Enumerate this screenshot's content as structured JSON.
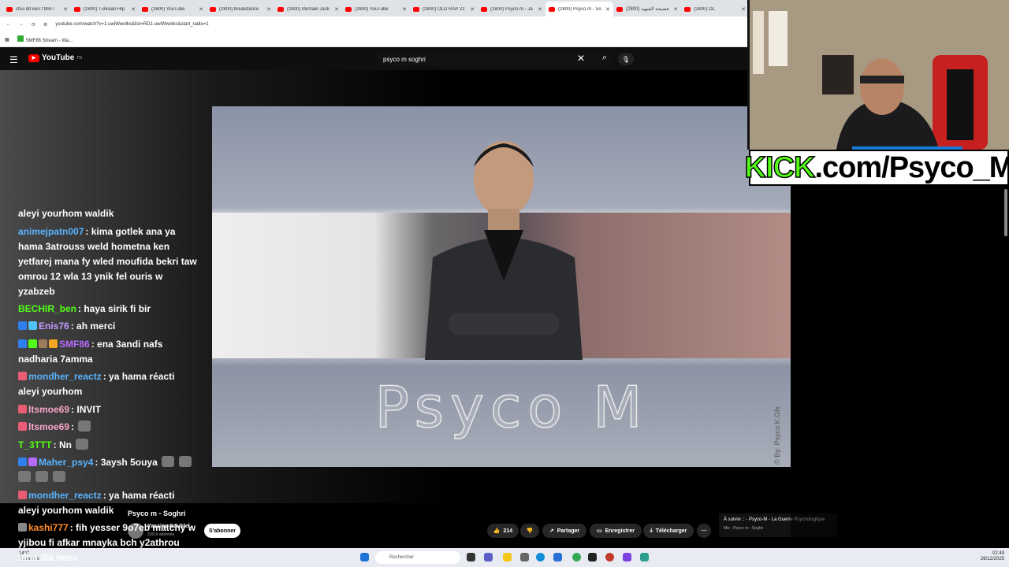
{
  "browser": {
    "tabs": [
      {
        "label": "chui dd ken f titre l",
        "active": false
      },
      {
        "label": "(2800) Tunisian Hip",
        "active": false
      },
      {
        "label": "(2800) YouTube",
        "active": false
      },
      {
        "label": "(2800) breakdance",
        "active": false
      },
      {
        "label": "(2800) Michael Jack",
        "active": false
      },
      {
        "label": "(2800) YouTube",
        "active": false
      },
      {
        "label": "(2800) OLD RAP 21",
        "active": false
      },
      {
        "label": "(2800) Psyco m - Ja",
        "active": false
      },
      {
        "label": "(2800) Psyco m - So",
        "active": true
      },
      {
        "label": "فضيحة الشهيد (2800)",
        "active": false
      },
      {
        "label": "(2800) OL",
        "active": false
      }
    ],
    "url": "youtube.com/watch?v=1-uwiWwolks&list=RD1-uwiWwolks&start_radio=1",
    "bookmarks": [
      "SMF86 Stream - Wa..."
    ]
  },
  "youtube": {
    "logo_text": "YouTube",
    "logo_sup": "TN",
    "search_value": "psyco m soghri",
    "video_overlay_text": "Psyco M",
    "video_watermark": "© By: Psyco K.Gfx",
    "video_title": "Psyco m - Soghri",
    "channel_name": "Yassine Bouhlel.",
    "subscriber_count": "3,83 k abonnés",
    "subscribe_label": "S'abonner",
    "like_count": "214",
    "share_label": "Partager",
    "save_label": "Enregistrer",
    "download_label": "Télécharger",
    "up_next_title": "À suivre :: - Psyco-M - La Guerre Psychologique",
    "up_next_sub": "Mix - Psyco m - Soghri"
  },
  "stream_banner": {
    "kick_text": "KICK",
    "rest_text": ".com/Psyco_M"
  },
  "chat": [
    {
      "user": "",
      "user_color": "#ffffff",
      "badges": [],
      "text": "aleyi yourhom waldik"
    },
    {
      "user": "animejpatn007",
      "user_color": "#5ab4ff",
      "badges": [],
      "text": ": kima gotlek ana ya hama 3atrouss weld hometna ken yetfarej mana fy wled moufida bekri taw omrou 12 wla 13 ynik fel ouris w yzabzeb"
    },
    {
      "user": "BECHIR_ben",
      "user_color": "#53fc18",
      "badges": [],
      "text": ": haya sirik fi bir"
    },
    {
      "user": "Enis76",
      "user_color": "#c39bff",
      "badges": [
        "#2f80ed",
        "#4fc3f7"
      ],
      "text": ": ah merci"
    },
    {
      "user": "SMF86",
      "user_color": "#b56bff",
      "badges": [
        "#2f80ed",
        "#53fc18",
        "#9e7b5a",
        "#f5a623"
      ],
      "text": ": ena 3andi nafs nadharia 7amma"
    },
    {
      "user": "mondher_reactz",
      "user_color": "#5ab4ff",
      "badges": [
        "#e85d75"
      ],
      "text": ": ya hama réacti aleyi yourhom"
    },
    {
      "user": "ltsmoe69",
      "user_color": "#f7a6c8",
      "badges": [
        "#e85d75"
      ],
      "text": ": INVIT"
    },
    {
      "user": "ltsmoe69",
      "user_color": "#f7a6c8",
      "badges": [
        "#e85d75"
      ],
      "text": ":",
      "emotes": 1
    },
    {
      "user": "T_3TTT",
      "user_color": "#53fc18",
      "badges": [],
      "text": ": Nn",
      "emotes": 1
    },
    {
      "user": "Maher_psy4",
      "user_color": "#5ab4ff",
      "badges": [
        "#2f80ed",
        "#b56bff"
      ],
      "text": ": 3aysh 5ouya",
      "emotes": 5
    },
    {
      "user": "mondher_reactz",
      "user_color": "#5ab4ff",
      "badges": [
        "#e85d75"
      ],
      "text": ": ya hama réacti aleyi yourhom waldik"
    },
    {
      "user": "kashi777",
      "user_color": "#ff8c2a",
      "badges": [
        "#888888"
      ],
      "text": ": fih yesser 9o7eb matchy w yjibou fi afkar mnayka bch y2athrou biha 3la ness"
    }
  ],
  "taskbar": {
    "weather_temp": "14°C",
    "weather_desc": "Éclaircies",
    "search_placeholder": "Rechercher",
    "time": "02:49",
    "date": "26/12/2025"
  }
}
